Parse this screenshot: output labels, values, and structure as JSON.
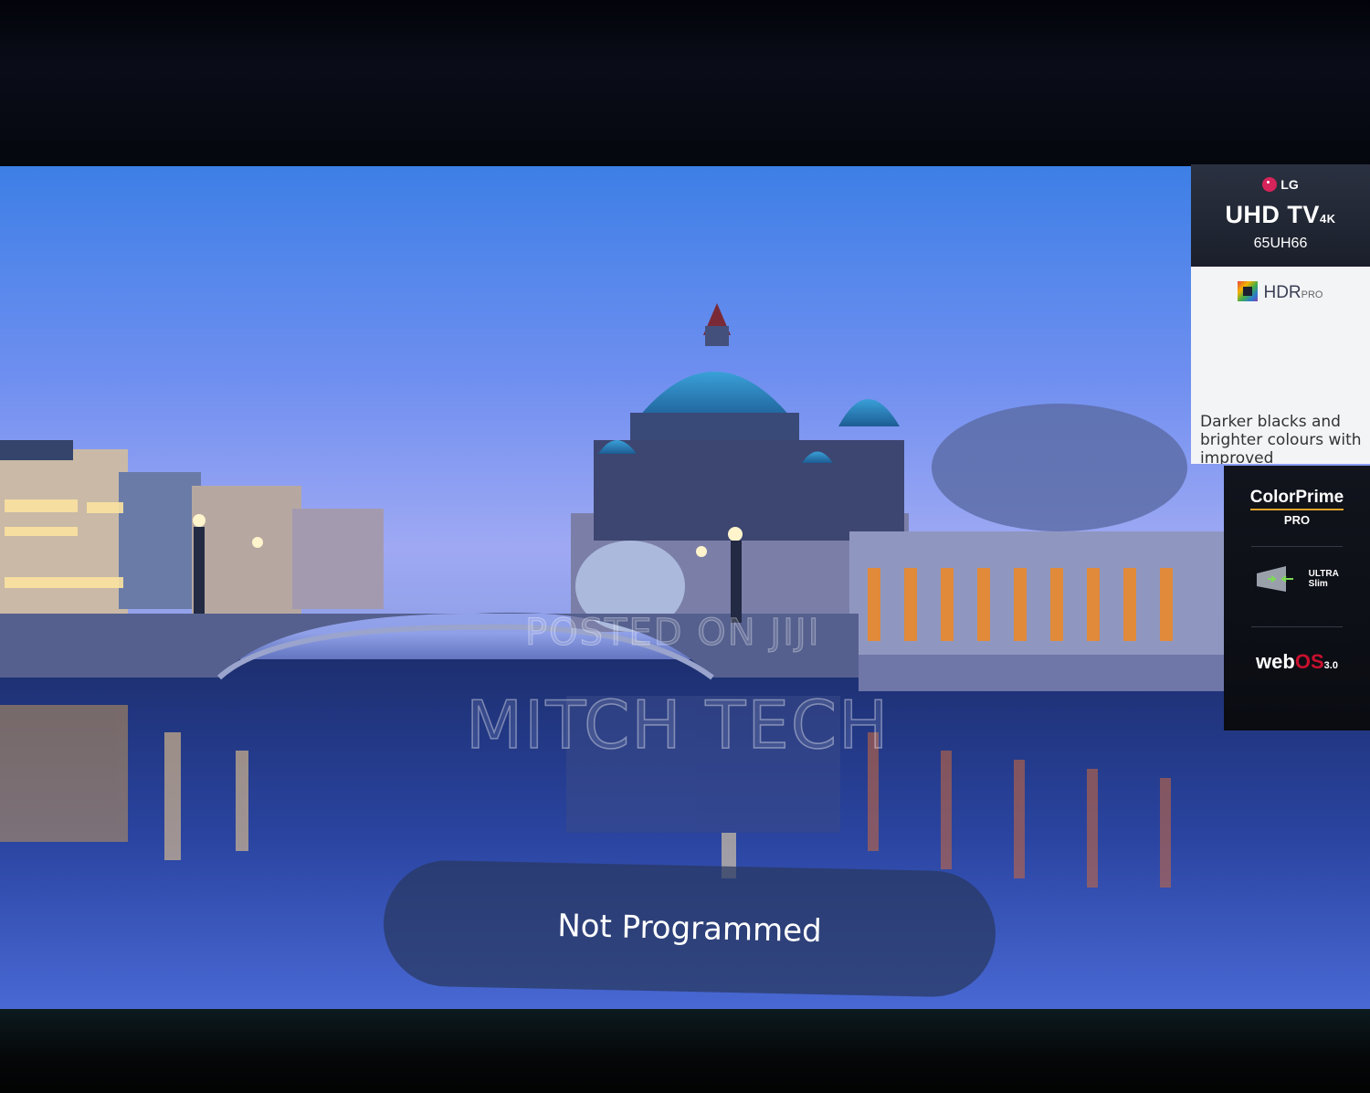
{
  "tv_panel": {
    "brand": "LG",
    "product": "UHD TV",
    "product_suffix": "4K",
    "model": "65UH66",
    "hdr_label": "HDR",
    "hdr_suffix": "PRO",
    "description": "Darker blacks and brighter colours with improved",
    "colorprime_label": "ColorPrime",
    "colorprime_suffix": "PRO",
    "ultraslim_line1": "ULTRA",
    "ultraslim_line2": "Slim",
    "webos_prefix": "web",
    "webos_os": "OS",
    "webos_version": "3.0"
  },
  "watermark": {
    "line1": "POSTED ON JIJI",
    "line2": "MITCH TECH"
  },
  "toast": {
    "message": "Not Programmed"
  },
  "colors": {
    "toast_bg": "#28375f",
    "lg_red": "#d6245a",
    "webos_red": "#c8102e",
    "colorprime_underline": "#e0a42a"
  }
}
